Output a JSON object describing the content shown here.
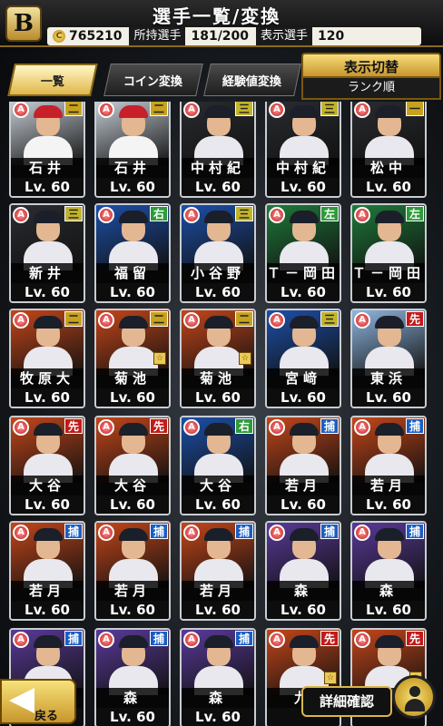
{
  "header": {
    "logo": "B",
    "title": "選手一覧/変換",
    "coins": "765210",
    "owned_label": "所持選手",
    "owned_value": "181/200",
    "display_label": "表示選手",
    "display_value": "120"
  },
  "tabs": [
    "一覧",
    "コイン変換",
    "経験値変換"
  ],
  "sort": {
    "title": "表示切替",
    "value": "ランク順"
  },
  "cards": [
    {
      "name": "石井",
      "lv": "Lv. 60",
      "pos": "二",
      "pos_type": "two",
      "theme": "red"
    },
    {
      "name": "石井",
      "lv": "Lv. 60",
      "pos": "二",
      "pos_type": "two",
      "theme": "red"
    },
    {
      "name": "中村紀",
      "lv": "Lv. 60",
      "pos": "三",
      "pos_type": "three",
      "theme": "dark"
    },
    {
      "name": "中村紀",
      "lv": "Lv. 60",
      "pos": "三",
      "pos_type": "three",
      "theme": "dark"
    },
    {
      "name": "松中",
      "lv": "Lv. 60",
      "pos": "一",
      "pos_type": "two",
      "theme": "dark"
    },
    {
      "name": "新井",
      "lv": "Lv. 60",
      "pos": "三",
      "pos_type": "three",
      "theme": "dark"
    },
    {
      "name": "福留",
      "lv": "Lv. 60",
      "pos": "右",
      "pos_type": "right",
      "theme": "blue"
    },
    {
      "name": "小谷野",
      "lv": "Lv. 60",
      "pos": "三",
      "pos_type": "three",
      "theme": "blue"
    },
    {
      "name": "Ｔ－岡田",
      "lv": "Lv. 60",
      "pos": "左",
      "pos_type": "left",
      "theme": "green"
    },
    {
      "name": "Ｔ－岡田",
      "lv": "Lv. 60",
      "pos": "左",
      "pos_type": "left",
      "theme": "green"
    },
    {
      "name": "牧原大",
      "lv": "Lv. 60",
      "pos": "二",
      "pos_type": "two",
      "theme": "fire"
    },
    {
      "name": "菊池",
      "lv": "Lv. 60",
      "pos": "二",
      "pos_type": "two",
      "theme": "fire",
      "star": true
    },
    {
      "name": "菊池",
      "lv": "Lv. 60",
      "pos": "二",
      "pos_type": "two",
      "theme": "fire",
      "star": true
    },
    {
      "name": "宮﨑",
      "lv": "Lv. 60",
      "pos": "三",
      "pos_type": "three",
      "theme": "blue"
    },
    {
      "name": "東浜",
      "lv": "Lv. 60",
      "pos": "先",
      "pos_type": "start",
      "theme": "sky"
    },
    {
      "name": "大谷",
      "lv": "Lv. 60",
      "pos": "先",
      "pos_type": "start",
      "theme": "fire"
    },
    {
      "name": "大谷",
      "lv": "Lv. 60",
      "pos": "先",
      "pos_type": "start",
      "theme": "fire"
    },
    {
      "name": "大谷",
      "lv": "Lv. 60",
      "pos": "右",
      "pos_type": "right",
      "theme": "blue"
    },
    {
      "name": "若月",
      "lv": "Lv. 60",
      "pos": "捕",
      "pos_type": "catch",
      "theme": "fire"
    },
    {
      "name": "若月",
      "lv": "Lv. 60",
      "pos": "捕",
      "pos_type": "catch",
      "theme": "fire"
    },
    {
      "name": "若月",
      "lv": "Lv. 60",
      "pos": "捕",
      "pos_type": "catch",
      "theme": "fire"
    },
    {
      "name": "若月",
      "lv": "Lv. 60",
      "pos": "捕",
      "pos_type": "catch",
      "theme": "fire"
    },
    {
      "name": "若月",
      "lv": "Lv. 60",
      "pos": "捕",
      "pos_type": "catch",
      "theme": "fire"
    },
    {
      "name": "森",
      "lv": "Lv. 60",
      "pos": "捕",
      "pos_type": "catch",
      "theme": "purple"
    },
    {
      "name": "森",
      "lv": "Lv. 60",
      "pos": "捕",
      "pos_type": "catch",
      "theme": "purple"
    },
    {
      "name": "",
      "lv": "",
      "pos": "捕",
      "pos_type": "catch",
      "theme": "purple"
    },
    {
      "name": "森",
      "lv": "Lv. 60",
      "pos": "捕",
      "pos_type": "catch",
      "theme": "purple"
    },
    {
      "name": "森",
      "lv": "Lv. 60",
      "pos": "捕",
      "pos_type": "catch",
      "theme": "purple"
    },
    {
      "name": "九",
      "lv": "",
      "pos": "先",
      "pos_type": "start",
      "theme": "fire",
      "star": true
    },
    {
      "name": "",
      "lv": "",
      "pos": "先",
      "pos_type": "start",
      "theme": "fire",
      "star": true
    }
  ],
  "themes": {
    "red": "#c8d0d8",
    "dark": "#2a2c30",
    "blue": "#1d4fa8",
    "green": "#1f7a3a",
    "fire": "#c4461a",
    "sky": "#8fb6e0",
    "purple": "#5a3a9a"
  },
  "footer": {
    "back_label": "戻る",
    "detail_label": "詳細確認"
  }
}
